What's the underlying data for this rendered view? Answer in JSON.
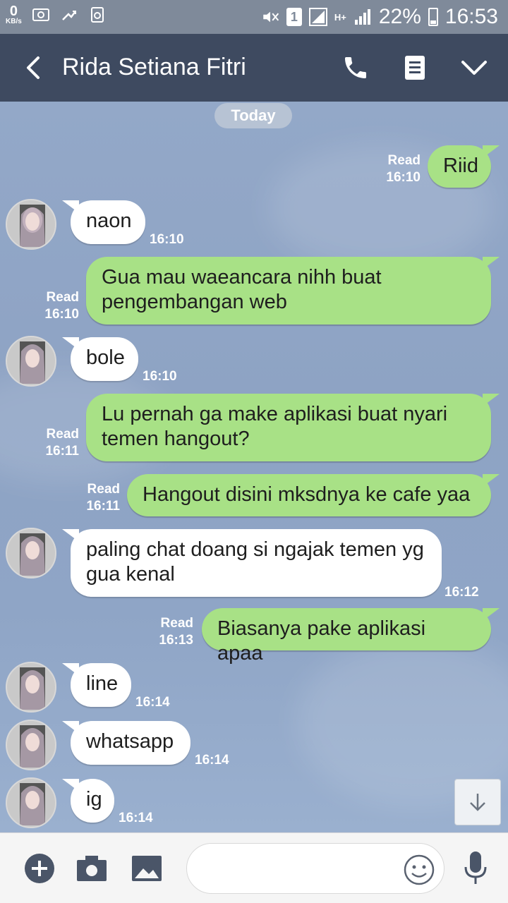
{
  "status_bar": {
    "net_speed_value": "0",
    "net_speed_unit": "KB/s",
    "sim_slot": "1",
    "network_type": "H+",
    "battery_percent": "22%",
    "time": "16:53"
  },
  "header": {
    "contact_name": "Rida Setiana Fitri"
  },
  "chat": {
    "date_label": "Today",
    "messages": [
      {
        "dir": "out",
        "text": "Riid",
        "read": "Read",
        "time": "16:10"
      },
      {
        "dir": "in",
        "text": "naon",
        "time": "16:10"
      },
      {
        "dir": "out",
        "text": "Gua mau waeancara nihh buat pengembangan web",
        "read": "Read",
        "time": "16:10"
      },
      {
        "dir": "in",
        "text": "bole",
        "time": "16:10"
      },
      {
        "dir": "out",
        "text": "Lu pernah ga make aplikasi buat nyari temen hangout?",
        "read": "Read",
        "time": "16:11"
      },
      {
        "dir": "out",
        "text": "Hangout disini mksdnya ke cafe yaa",
        "read": "Read",
        "time": "16:11"
      },
      {
        "dir": "in",
        "text": "paling chat doang si ngajak temen yg gua kenal",
        "time": "16:12"
      },
      {
        "dir": "out",
        "text": "Biasanya pake aplikasi apaa",
        "read": "Read",
        "time": "16:13"
      },
      {
        "dir": "in",
        "text": "line",
        "time": "16:14"
      },
      {
        "dir": "in",
        "text": "whatsapp",
        "time": "16:14"
      },
      {
        "dir": "in",
        "text": "ig",
        "time": "16:14"
      }
    ]
  },
  "input": {
    "placeholder": ""
  },
  "icons": {
    "back": "back-arrow-icon",
    "call": "phone-icon",
    "notes": "note-icon",
    "menu": "chevron-down-icon",
    "add": "plus-icon",
    "camera": "camera-icon",
    "gallery": "image-icon",
    "emoji": "emoji-icon",
    "voice": "microphone-icon",
    "scroll_down": "arrow-down-icon"
  },
  "colors": {
    "header_bg": "#3e4a60",
    "outgoing_bubble": "#a8e186",
    "incoming_bubble": "#ffffff",
    "chat_bg": "#8fa5c6"
  }
}
